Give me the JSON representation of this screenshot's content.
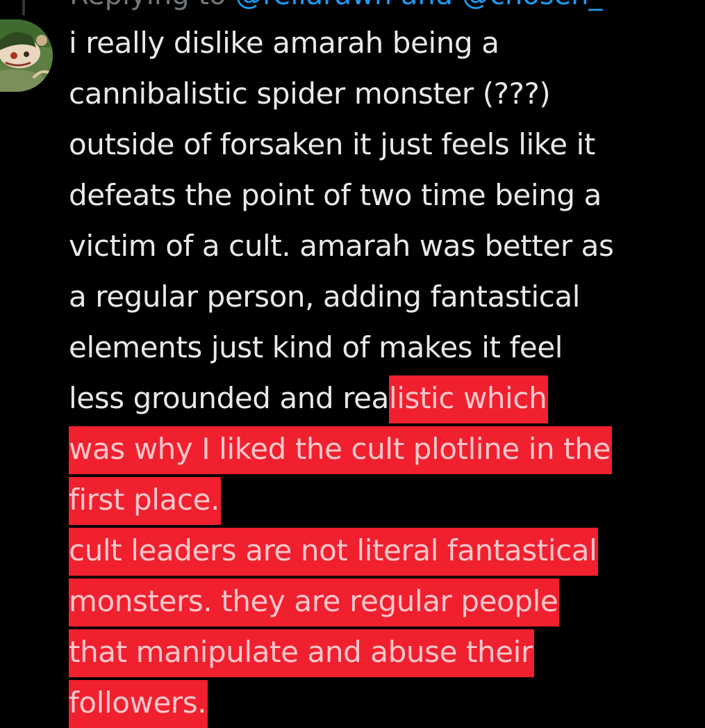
{
  "reply_header": {
    "prefix": "Replying to ",
    "mentions": "@rellarawn and @chosen_"
  },
  "tweet": {
    "lines": [
      {
        "plain": "i really dislike amarah being a",
        "highlight": ""
      },
      {
        "plain": "cannibalistic spider monster (???)",
        "highlight": ""
      },
      {
        "plain": "outside of forsaken it just feels like it",
        "highlight": ""
      },
      {
        "plain": "defeats the point of two time being a",
        "highlight": ""
      },
      {
        "plain": "victim of a cult. amarah was better as",
        "highlight": ""
      },
      {
        "plain": "a regular person, adding fantastical",
        "highlight": ""
      },
      {
        "plain": "elements just kind of makes it feel",
        "highlight": ""
      },
      {
        "plain": "less grounded and rea",
        "highlight": "listic which"
      },
      {
        "plain": "",
        "highlight": "was why I liked the cult plotline in the"
      },
      {
        "plain": "",
        "highlight": "first place."
      },
      {
        "plain": "",
        "highlight": "cult leaders are not literal fantastical"
      },
      {
        "plain": "",
        "highlight": "monsters. they are regular people"
      },
      {
        "plain": "",
        "highlight": "that manipulate and abuse their"
      },
      {
        "plain": "",
        "highlight": "followers."
      }
    ]
  },
  "colors": {
    "background": "#000000",
    "text": "#e7e9ea",
    "highlight_bg": "#f0202f",
    "highlight_text": "#ffc7cc",
    "mention": "#1d9bf0"
  }
}
